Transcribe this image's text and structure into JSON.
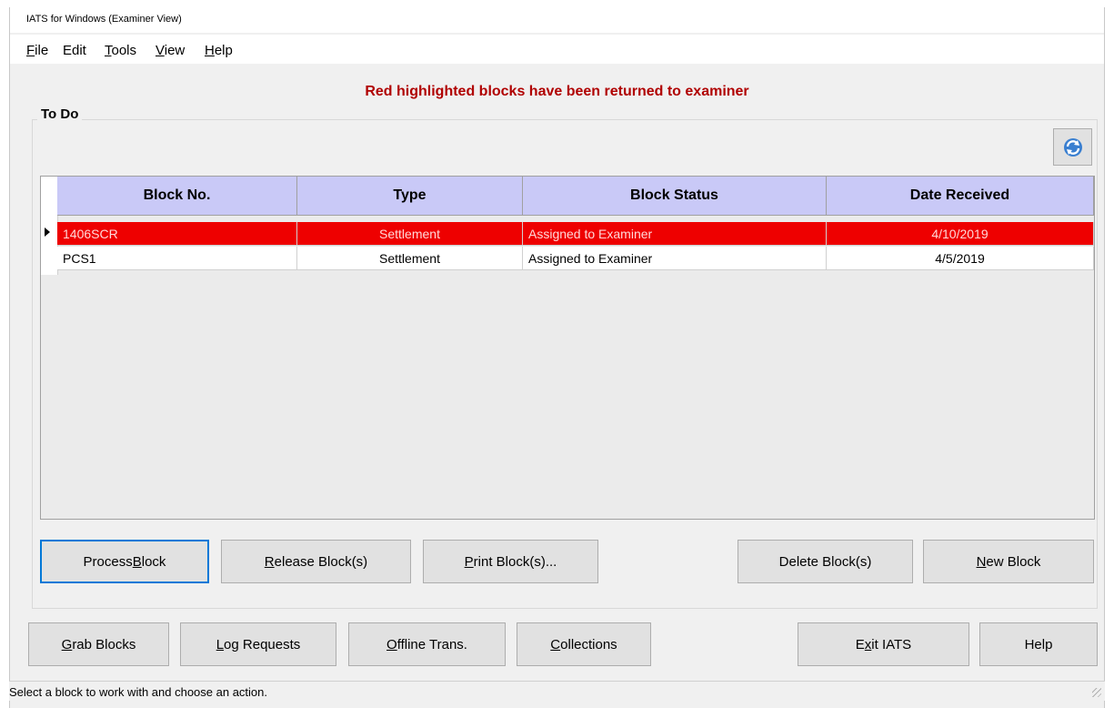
{
  "window": {
    "title": "IATS for Windows (Examiner View)"
  },
  "menu": [
    {
      "label": "File",
      "underline": "F",
      "rest": "ile"
    },
    {
      "label": "Edit",
      "underline": "",
      "rest": "Edit"
    },
    {
      "label": "Tools",
      "underline": "T",
      "rest": "ools"
    },
    {
      "label": "View",
      "underline": "V",
      "rest": "iew"
    },
    {
      "label": "Help",
      "underline": "H",
      "rest": "elp"
    }
  ],
  "notice": "Red highlighted blocks have been returned to examiner",
  "todo": {
    "label": "To Do",
    "refresh_icon": "refresh-icon",
    "columns": [
      "Block No.",
      "Type",
      "Block Status",
      "Date Received"
    ],
    "rows": [
      {
        "block_no": "1406SCR",
        "type": "Settlement",
        "status": "Assigned to Examiner",
        "date": "4/10/2019",
        "selected": true
      },
      {
        "block_no": "PCS1",
        "type": "Settlement",
        "status": "Assigned to Examiner",
        "date": "4/5/2019",
        "selected": false
      }
    ]
  },
  "buttons": {
    "process": {
      "pre": "Process ",
      "ul": "B",
      "post": "lock"
    },
    "release": {
      "pre": "",
      "ul": "R",
      "post": "elease Block(s)"
    },
    "print": {
      "pre": "",
      "ul": "P",
      "post": "rint Block(s)..."
    },
    "delete": {
      "pre": "Delete Block(s)",
      "ul": "",
      "post": ""
    },
    "new": {
      "pre": "",
      "ul": "N",
      "post": "ew Block"
    },
    "grab": {
      "pre": "",
      "ul": "G",
      "post": "rab Blocks"
    },
    "log": {
      "pre": "",
      "ul": "L",
      "post": "og Requests"
    },
    "offline": {
      "pre": "",
      "ul": "O",
      "post": "ffline Trans."
    },
    "collections": {
      "pre": "",
      "ul": "C",
      "post": "ollections"
    },
    "exit": {
      "pre": "E",
      "ul": "x",
      "post": "it IATS"
    },
    "help": {
      "pre": "Help",
      "ul": "",
      "post": ""
    }
  },
  "status_bar": "Select a block to work with and choose an action.",
  "colors": {
    "selected_row": "#ee0000",
    "header": "#c9c9f7",
    "notice": "#b00000"
  }
}
